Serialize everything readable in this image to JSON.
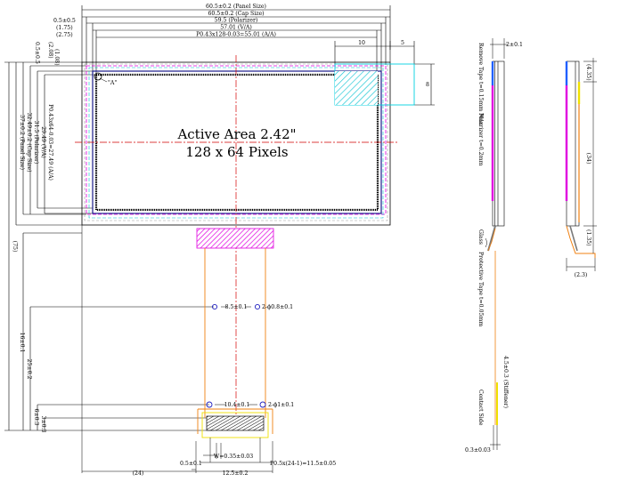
{
  "colors": {
    "line": "#000000",
    "center_line": "#d40000",
    "polarizer_outline": "#e000e0",
    "cap_outline": "#9a9a9a",
    "active_border": "#1a1a8a",
    "highlight_box": "#00d0e0",
    "fpc_orange": "#f08010",
    "yellow": "#f0e000",
    "hole_blue": "#2020c0"
  },
  "top_dims": {
    "panel": "60.5±0.2 (Panel Size)",
    "cap": "60.5±0.2 (Cap Size)",
    "polarizer": "59.5 (Polarizer)",
    "va": "57.01 (V/A)",
    "aa": "P0.43x128-0.03=55.01 (A/A)",
    "left_05": "0.5±0.5",
    "left_175": "(1.75)",
    "left_275": "(2.75)",
    "d10": "10",
    "d5": "5",
    "d8": "8"
  },
  "left_dims": {
    "top_05": "0.5±0.5",
    "top_208": "(2.08)",
    "top_108": "(1.08)",
    "aa": "P0.43x64-0.03=27.49 (A/A)",
    "va": "29.49 (V/A)",
    "polarizer": "31.5 (Polarizer)",
    "cap": "32.49±0.2 (Cap Size)",
    "panel": "37±0.2 (Panel Size)",
    "total": "(75)",
    "d16": "16±0.1",
    "d25": "25±0.2",
    "d6": "6±0.3",
    "d3": "3±0.3"
  },
  "labels": {
    "title_line1": "Active Area 2.42\"",
    "title_line2": "128 x 64 Pixels",
    "detail_a": "\"A\""
  },
  "fpc_dims": {
    "upper_pitch": "8.5±0.1",
    "upper_hole": "2-ϕ0.8±0.1",
    "lower_pitch": "10.4±0.1",
    "lower_hole": "2-ϕ1±0.1",
    "w": "W=0.35±0.03",
    "pitch": "P0.5x(24-1)=11.5±0.05",
    "d05": "0.5±0.1",
    "d125": "12.5±0.2",
    "d24": "(24)"
  },
  "side_view_1": {
    "top_dim": "2±0.1",
    "remove_tape": "Remove Tape t=0.15mm Max",
    "polarizer": "Polarizer t=0.2mm",
    "glass": "Glass",
    "protective_tape": "Protective Tape t=0.05mm",
    "stiffener": "4.5±0.3 (Stiffener)",
    "contact_side": "Contact Side",
    "bottom_dim": "0.3±0.03"
  },
  "side_view_2": {
    "d435": "(4.35)",
    "d34": "(34)",
    "d135": "(1.35)",
    "d23": "(2.3)"
  }
}
